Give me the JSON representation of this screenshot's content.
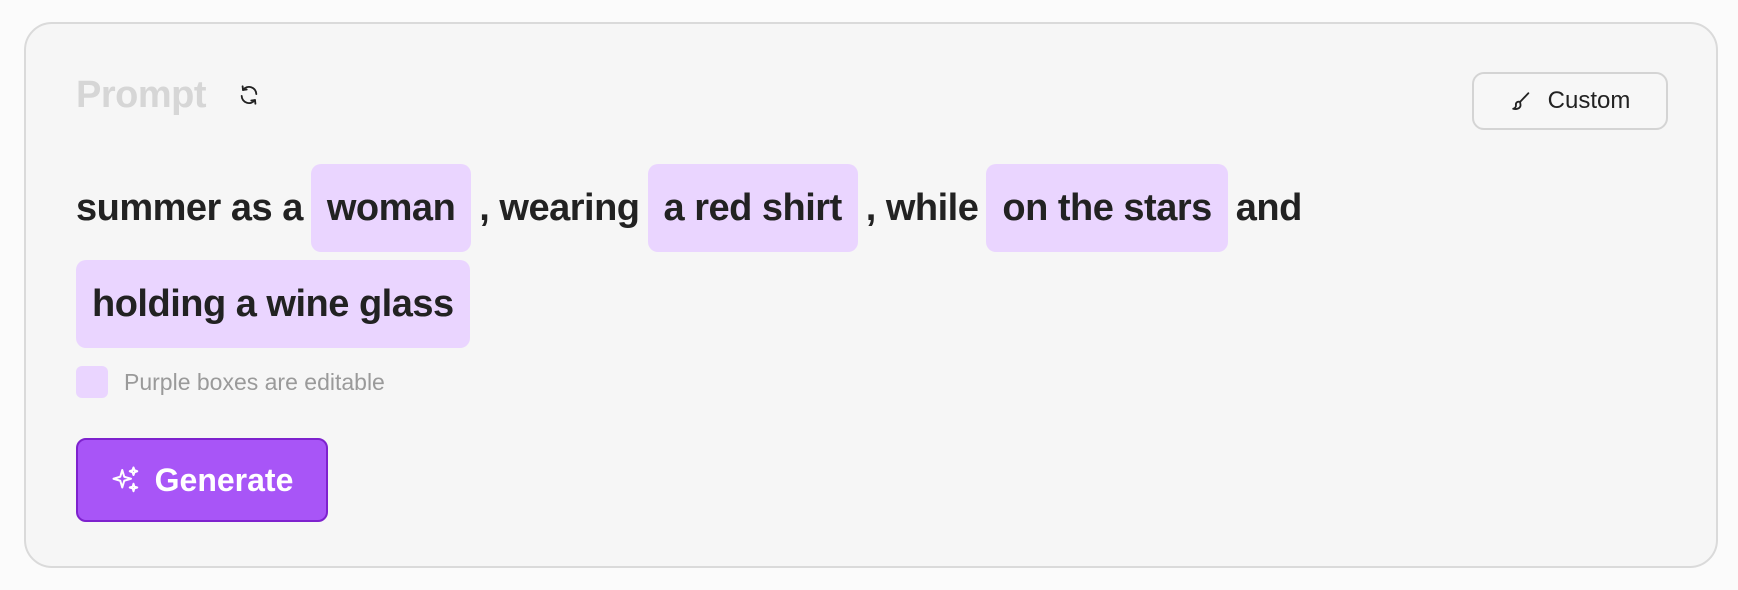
{
  "header": {
    "title": "Prompt",
    "refresh_icon": "refresh-icon"
  },
  "custom_button": {
    "icon": "brush-icon",
    "label": "Custom"
  },
  "sentence": {
    "text_1": "summer as a",
    "chip_1": "woman",
    "text_2": ", wearing",
    "chip_2": "a red shirt",
    "text_3": ", while",
    "chip_3": "on the stars",
    "text_4": "and",
    "chip_4": "holding a wine glass"
  },
  "hint": {
    "text": "Purple boxes are editable"
  },
  "generate_button": {
    "icon": "sparkles-icon",
    "label": "Generate"
  },
  "colors": {
    "chip_background": "#ead5ff",
    "accent": "#a855f7",
    "accent_border": "#7e22ce",
    "text": "#222222",
    "muted": "#9a9a9a"
  }
}
